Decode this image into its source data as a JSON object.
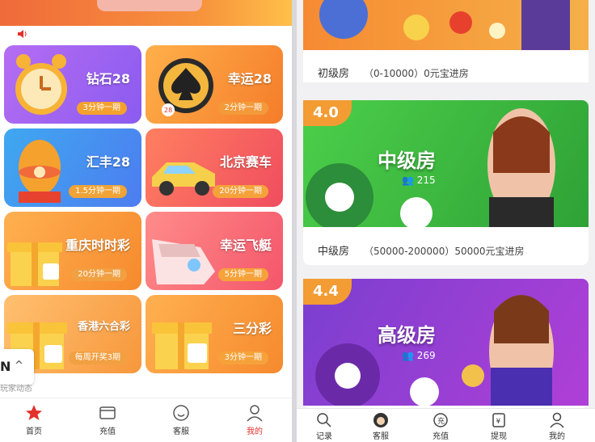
{
  "left": {
    "speaker_icon": "speaker-icon",
    "games": [
      {
        "name": "钻石28",
        "period": "3分钟一期"
      },
      {
        "name": "幸运28",
        "period": "2分钟一期"
      },
      {
        "name": "汇丰28",
        "period": "1.5分钟一期"
      },
      {
        "name": "北京赛车",
        "period": "20分钟一期"
      },
      {
        "name": "重庆时时彩",
        "period": "20分钟一期"
      },
      {
        "name": "幸运飞艇",
        "period": "5分钟一期"
      },
      {
        "name": "香港六合彩",
        "period": "每周开奖3期"
      },
      {
        "name": "三分彩",
        "period": "3分钟一期"
      }
    ],
    "overlay": {
      "letter": "N",
      "caret": "^",
      "faded": "玩家动态"
    },
    "tabbar": [
      {
        "label": "首页",
        "icon": "star-icon",
        "active": true
      },
      {
        "label": "充值",
        "icon": "wallet-icon"
      },
      {
        "label": "客服",
        "icon": "smile-icon"
      },
      {
        "label": "我的",
        "icon": "user-icon",
        "active_color": "#e2312b"
      }
    ]
  },
  "right": {
    "rooms": [
      {
        "caption": "初级房",
        "range": "（0-10000）0元宝进房"
      },
      {
        "level": "4.0",
        "title": "中级房",
        "online": "215",
        "caption": "中级房",
        "range": "（50000-200000）50000元宝进房"
      },
      {
        "level": "4.4",
        "title": "高级房",
        "online": "269"
      }
    ],
    "tabbar": [
      {
        "label": "记录",
        "icon": "search-icon"
      },
      {
        "label": "客服",
        "icon": "avatar-icon"
      },
      {
        "label": "充值",
        "icon": "coin-icon"
      },
      {
        "label": "提现",
        "icon": "withdraw-icon"
      },
      {
        "label": "我的",
        "icon": "user-icon"
      }
    ]
  },
  "colors": {
    "accent": "#e2312b",
    "orange": "#f39c33"
  }
}
